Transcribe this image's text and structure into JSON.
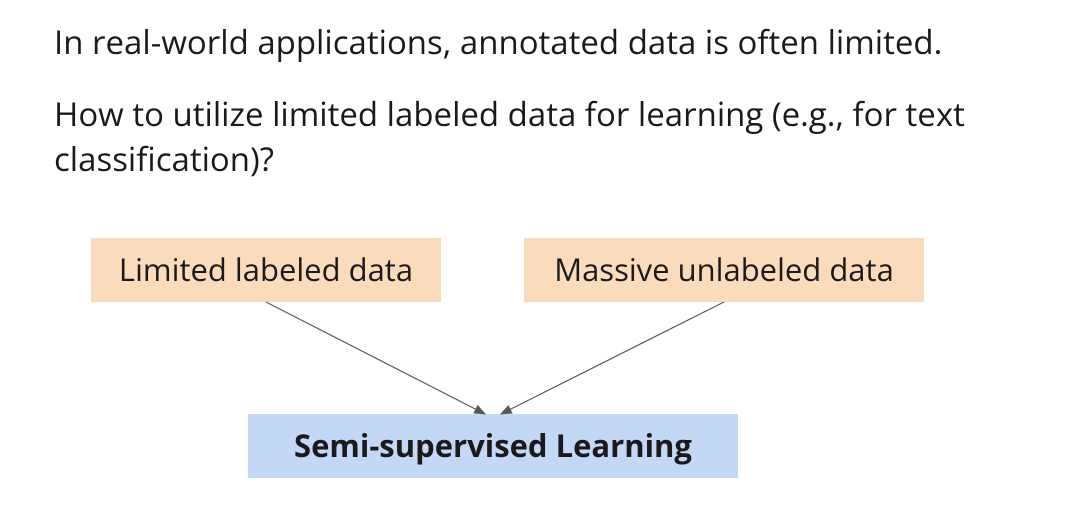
{
  "text": {
    "line1": "In real-world applications, annotated data is often limited.",
    "line2": "How to utilize limited labeled data for learning (e.g., for text classification)?"
  },
  "boxes": {
    "labeled": "Limited labeled data",
    "unlabeled": "Massive unlabeled data",
    "result": "Semi-supervised Learning"
  },
  "colors": {
    "source_box_bg": "#fadcbd",
    "result_box_bg": "#c3d8f5",
    "arrow": "#5a5a5a"
  }
}
